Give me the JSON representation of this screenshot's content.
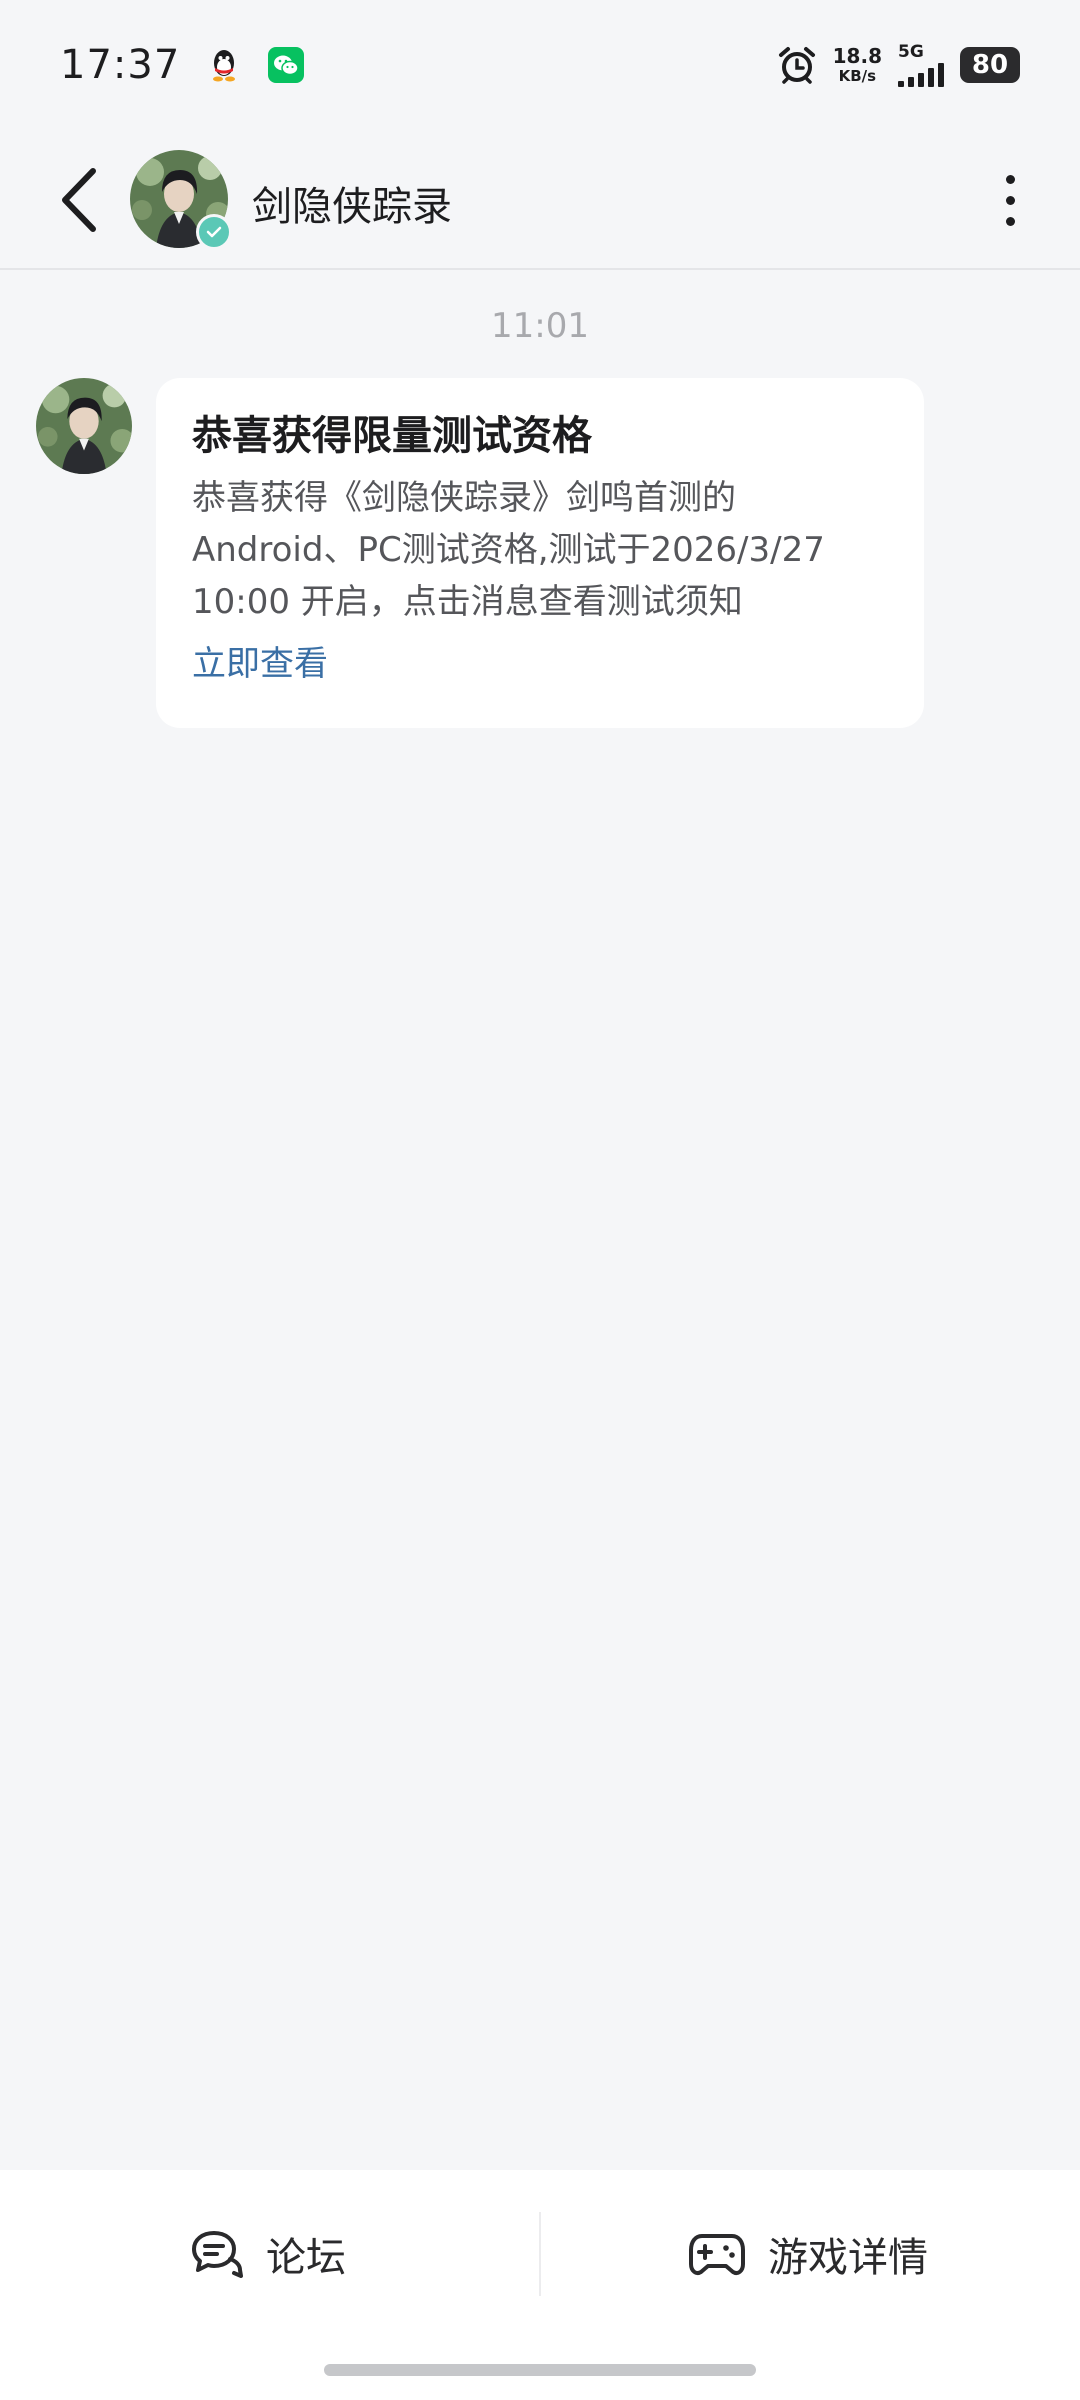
{
  "status_bar": {
    "time": "17:37",
    "net_speed_value": "18.8",
    "net_speed_unit": "KB/s",
    "network_type": "5G",
    "battery_level": "80",
    "icons": [
      "qq-icon",
      "wechat-icon",
      "alarm-icon",
      "signal-icon",
      "battery-icon"
    ]
  },
  "header": {
    "title": "剑隐侠踪录",
    "verified": true,
    "icons": [
      "back-arrow-icon",
      "more-icon"
    ]
  },
  "chat": {
    "timestamp": "11:01",
    "message": {
      "title": "恭喜获得限量测试资格",
      "body": "恭喜获得《剑隐侠踪录》剑鸣首测的\nAndroid、PC测试资格,测试于2026/3/27\n10:00 开启，点击消息查看测试须知",
      "link": "立即查看"
    }
  },
  "bottom_bar": {
    "forum_label": "论坛",
    "game_detail_label": "游戏详情",
    "icons": [
      "forum-icon",
      "gamepad-icon"
    ]
  },
  "colors": {
    "background": "#f5f6f8",
    "card": "#ffffff",
    "link": "#3a6fa5",
    "verified_badge": "#5bc8b6",
    "wechat": "#07c160"
  }
}
